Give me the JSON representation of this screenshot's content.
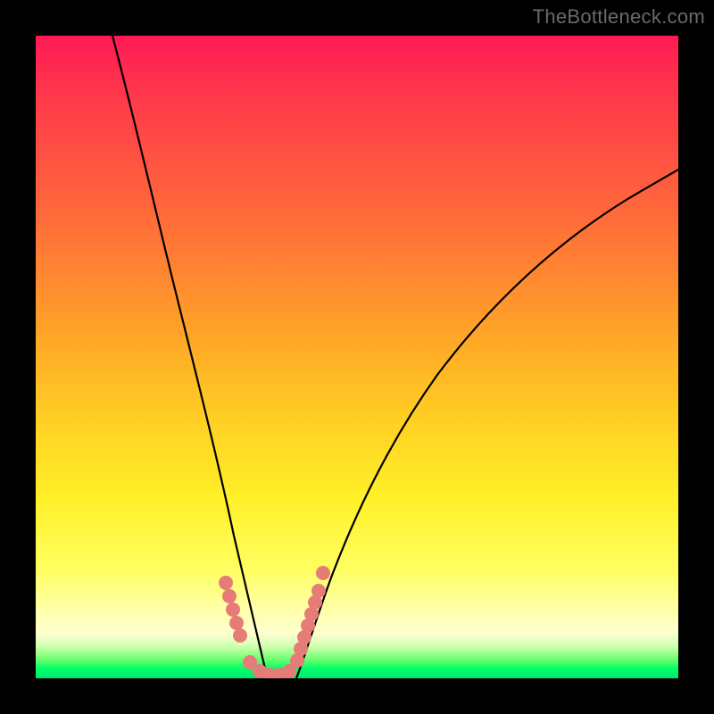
{
  "watermark": "TheBottleneck.com",
  "chart_data": {
    "type": "line",
    "title": "",
    "xlabel": "",
    "ylabel": "",
    "xlim": [
      0,
      100
    ],
    "ylim": [
      0,
      100
    ],
    "series": [
      {
        "name": "left-curve",
        "x": [
          12,
          14,
          16,
          18,
          20,
          22,
          24,
          26,
          28,
          30,
          32,
          34,
          35
        ],
        "y": [
          100,
          92,
          83,
          74,
          65,
          56,
          47,
          38,
          29,
          20,
          12,
          5,
          0
        ]
      },
      {
        "name": "right-curve",
        "x": [
          40,
          42,
          45,
          48,
          52,
          56,
          60,
          65,
          70,
          76,
          82,
          88,
          94,
          100
        ],
        "y": [
          0,
          6,
          14,
          22,
          30,
          37,
          43,
          50,
          56,
          62,
          67,
          72,
          76,
          80
        ]
      }
    ],
    "markers": {
      "name": "highlight-dots-salmon",
      "left_cluster": [
        [
          29.3,
          14.5
        ],
        [
          29.8,
          12.5
        ],
        [
          30.3,
          10.5
        ],
        [
          30.9,
          8.5
        ],
        [
          31.5,
          6.5
        ]
      ],
      "trough": [
        [
          33.0,
          2.2
        ],
        [
          34.5,
          1.0
        ],
        [
          36.0,
          0.8
        ],
        [
          37.5,
          0.8
        ],
        [
          39.0,
          1.0
        ]
      ],
      "right_cluster": [
        [
          40.4,
          2.6
        ],
        [
          40.9,
          4.4
        ],
        [
          41.4,
          6.2
        ],
        [
          41.9,
          8.0
        ],
        [
          42.4,
          9.8
        ],
        [
          42.9,
          11.6
        ],
        [
          43.4,
          13.4
        ],
        [
          44.1,
          16.2
        ]
      ]
    },
    "colors": {
      "curve": "#000000",
      "marker": "#e77b78",
      "gradient_top": "#ff1a55",
      "gradient_mid": "#ffe030",
      "gradient_bottom": "#00e676",
      "frame": "#000000"
    }
  }
}
